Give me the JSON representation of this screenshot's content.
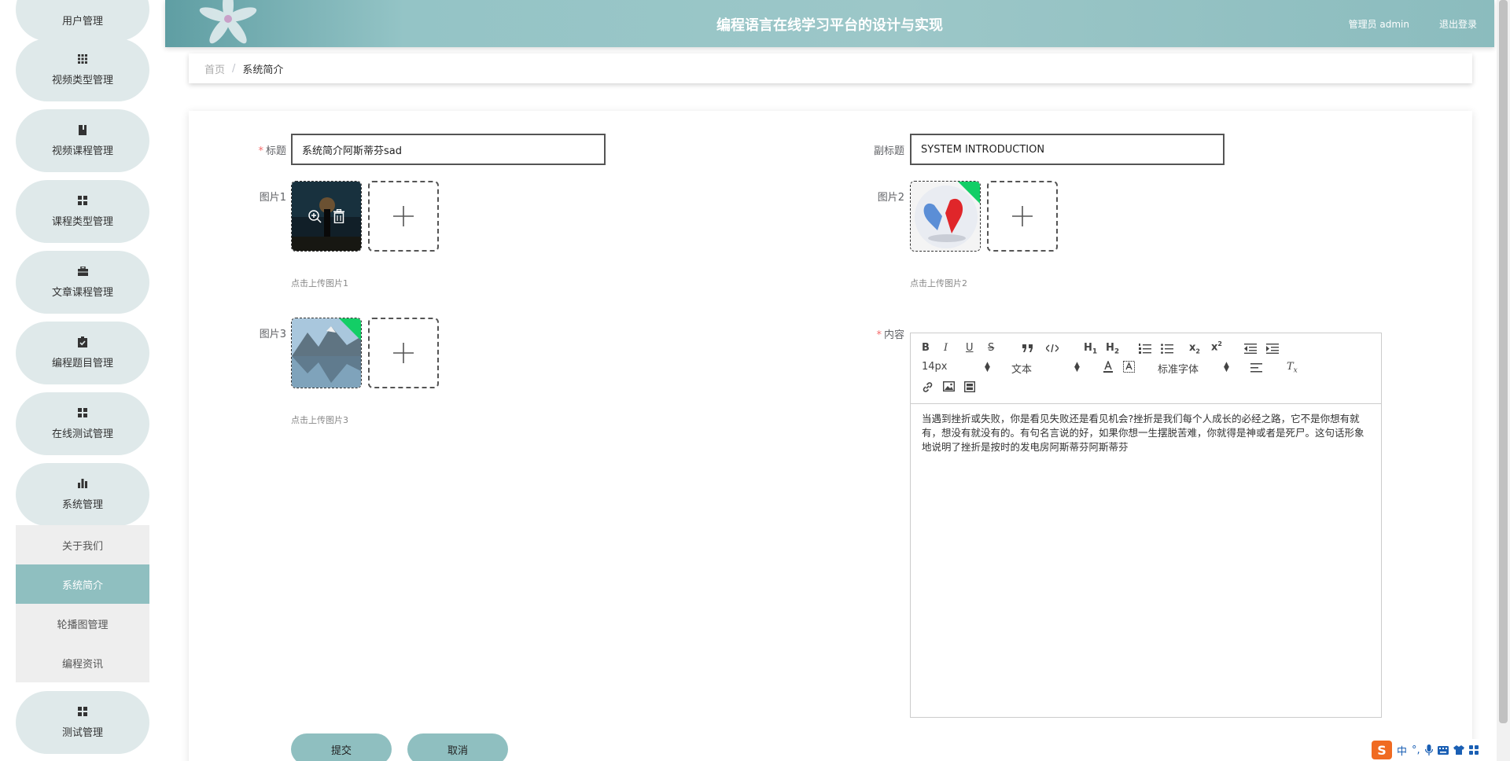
{
  "sidebar": {
    "items": [
      {
        "label": "用户管理",
        "icon": "user-icon"
      },
      {
        "label": "视频类型管理",
        "icon": "grid-icon"
      },
      {
        "label": "视频课程管理",
        "icon": "book-icon"
      },
      {
        "label": "课程类型管理",
        "icon": "grid-icon"
      },
      {
        "label": "文章课程管理",
        "icon": "briefcase-icon"
      },
      {
        "label": "编程题目管理",
        "icon": "clipboard-check-icon"
      },
      {
        "label": "在线测试管理",
        "icon": "grid-icon"
      },
      {
        "label": "系统管理",
        "icon": "bar-chart-icon"
      },
      {
        "label": "测试管理",
        "icon": "grid-icon"
      }
    ],
    "submenu": [
      {
        "label": "关于我们",
        "active": false
      },
      {
        "label": "系统简介",
        "active": true
      },
      {
        "label": "轮播图管理",
        "active": false
      },
      {
        "label": "编程资讯",
        "active": false
      }
    ]
  },
  "header": {
    "title": "编程语言在线学习平台的设计与实现",
    "user": "管理员 admin",
    "logout": "退出登录"
  },
  "breadcrumb": {
    "home": "首页",
    "separator": "/",
    "current": "系统简介"
  },
  "form": {
    "title_label": "标题",
    "title_value": "系统简介阿斯蒂芬sad",
    "subtitle_label": "副标题",
    "subtitle_value": "SYSTEM INTRODUCTION",
    "image1_label": "图片1",
    "image1_hint": "点击上传图片1",
    "image2_label": "图片2",
    "image2_hint": "点击上传图片2",
    "image3_label": "图片3",
    "image3_hint": "点击上传图片3",
    "content_label": "内容",
    "content_text": "当遇到挫折或失败，你是看见失败还是看见机会?挫折是我们每个人成长的必经之路，它不是你想有就有，想没有就没有的。有句名言说的好，如果你想一生摆脱苦难，你就得是神或者是死尸。这句话形象地说明了挫折是按时的发电房阿斯蒂芬阿斯蒂芬",
    "submit_label": "提交",
    "cancel_label": "取消"
  },
  "editor": {
    "font_size": "14px",
    "block_type": "文本",
    "font_family": "标准字体",
    "tools": [
      "B",
      "I",
      "U",
      "S",
      "quote",
      "code",
      "H1",
      "H2",
      "ordered-list",
      "bullet-list",
      "subscript",
      "superscript",
      "outdent",
      "indent",
      "font-color",
      "background-color",
      "align",
      "clear-format",
      "link",
      "image",
      "video"
    ]
  },
  "ime": {
    "lang": "中",
    "punct": "°,"
  },
  "colors": {
    "accent": "#8fbfc0",
    "header_bg": "#9cc7c8",
    "nav_bg": "#dfe9ea",
    "required": "#f56c6c",
    "badge_green": "#13ce66"
  }
}
